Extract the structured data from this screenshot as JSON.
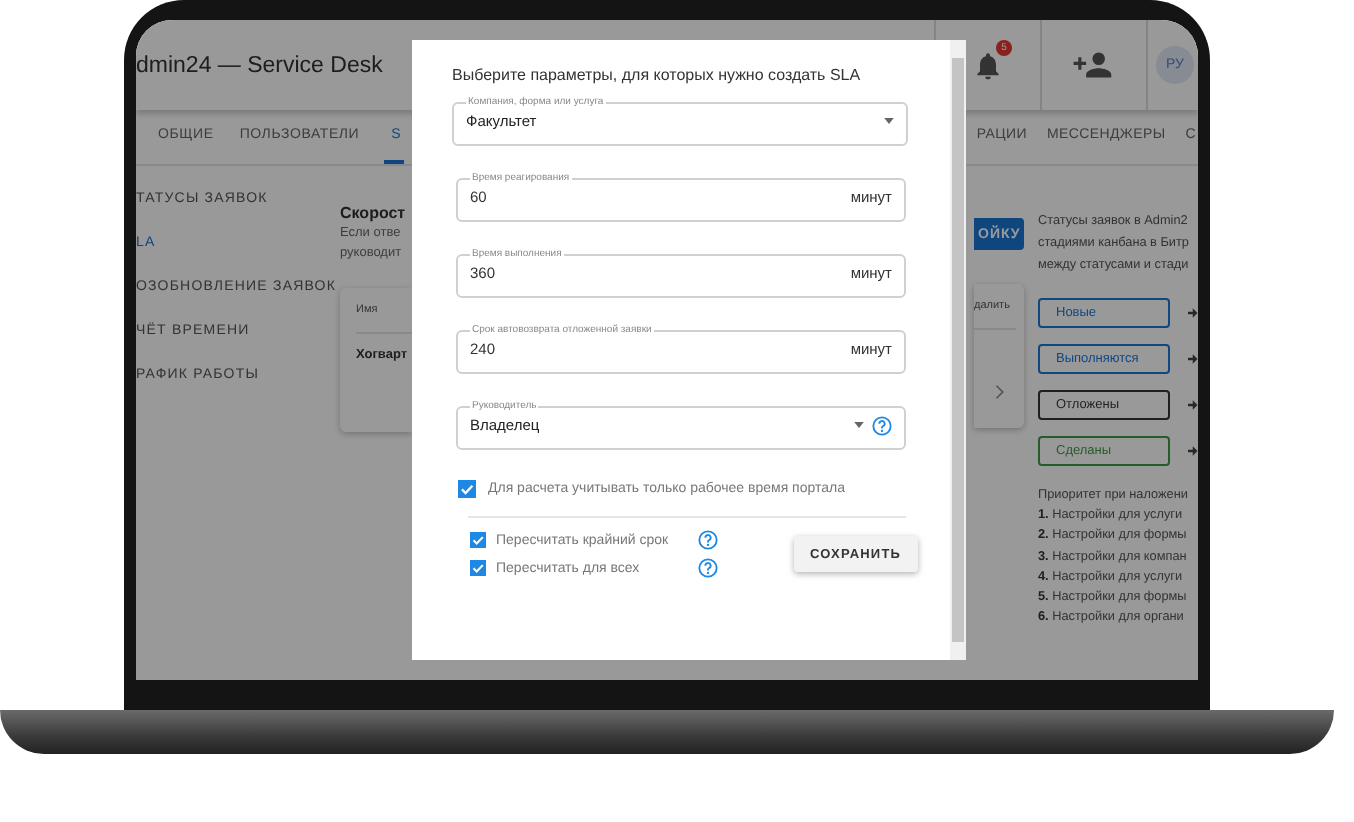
{
  "app": {
    "title": "dmin24 — Service Desk",
    "notifications": "5",
    "avatar": "РУ"
  },
  "tabs": [
    {
      "label": "ОБЩИЕ",
      "selected": false
    },
    {
      "label": "ПОЛЬЗОВАТЕЛИ",
      "selected": false
    },
    {
      "label": "S",
      "selected": true
    },
    {
      "label": "РАЦИИ",
      "selected": false
    },
    {
      "label": "МЕССЕНДЖЕРЫ",
      "selected": false
    },
    {
      "label": "С",
      "selected": false
    }
  ],
  "sidebar": {
    "items": [
      {
        "label": "ТАТУСЫ ЗАЯВОК",
        "selected": false
      },
      {
        "label": "LA",
        "selected": true
      },
      {
        "label": "ОЗОБНОВЛЕНИЕ ЗАЯВОК",
        "selected": false
      },
      {
        "label": "ЧЁТ ВРЕМЕНИ",
        "selected": false
      },
      {
        "label": "РАФИК РАБОТЫ",
        "selected": false
      }
    ]
  },
  "main": {
    "heading": "Скорост",
    "description_lines": [
      "Если отве",
      "руководит"
    ],
    "table": {
      "column_1": "Имя",
      "row_1": "Хогварт",
      "action": "далить"
    },
    "button": "ОЙКУ"
  },
  "statuses_panel": {
    "description_lines": [
      "Статусы заявок в Admin2",
      "стадиями канбана в Битр",
      "между статусами и стади"
    ],
    "statuses": [
      {
        "label": "Новые",
        "color": "#0f477e"
      },
      {
        "label": "Выполняются",
        "color": "#0f477e"
      },
      {
        "label": "Отложены",
        "color": "#1f1f1f"
      },
      {
        "label": "Сделаны",
        "color": "#265c29"
      }
    ],
    "priority_title": "Приоритет при наложени",
    "priority": [
      {
        "number": "1.",
        "text": "Настройки для услуги"
      },
      {
        "number": "2.",
        "text": "Настройки для формы"
      },
      {
        "number": "3.",
        "text": "Настройки для компан"
      },
      {
        "number": "4.",
        "text": "Настройки для услуги"
      },
      {
        "number": "5.",
        "text": "Настройки для формы"
      },
      {
        "number": "6.",
        "text": "Настройки для органи"
      }
    ]
  },
  "dialog": {
    "title": "Выберите параметры, для которых нужно создать SLA",
    "fields": [
      {
        "kind": "select",
        "label": "Компания, форма или услуга",
        "value": "Факультет",
        "help": false
      },
      {
        "kind": "number",
        "label": "Время реагирования",
        "value": "60",
        "unit": "минут"
      },
      {
        "kind": "number",
        "label": "Время выполнения",
        "value": "360",
        "unit": "минут"
      },
      {
        "kind": "number",
        "label": "Срок автовозврата отложенной заявки",
        "value": "240",
        "unit": "минут"
      },
      {
        "kind": "select",
        "label": "Руководитель",
        "value": "Владелец",
        "help": true
      }
    ],
    "working_time": {
      "label": "Для расчета учитывать только рабочее время портала",
      "checked": true
    },
    "options": [
      {
        "label": "Пересчитать крайний срок",
        "checked": true,
        "help": true
      },
      {
        "label": "Пересчитать для всех",
        "checked": true,
        "help": true
      }
    ],
    "save_button": "СОХРАНИТЬ"
  }
}
